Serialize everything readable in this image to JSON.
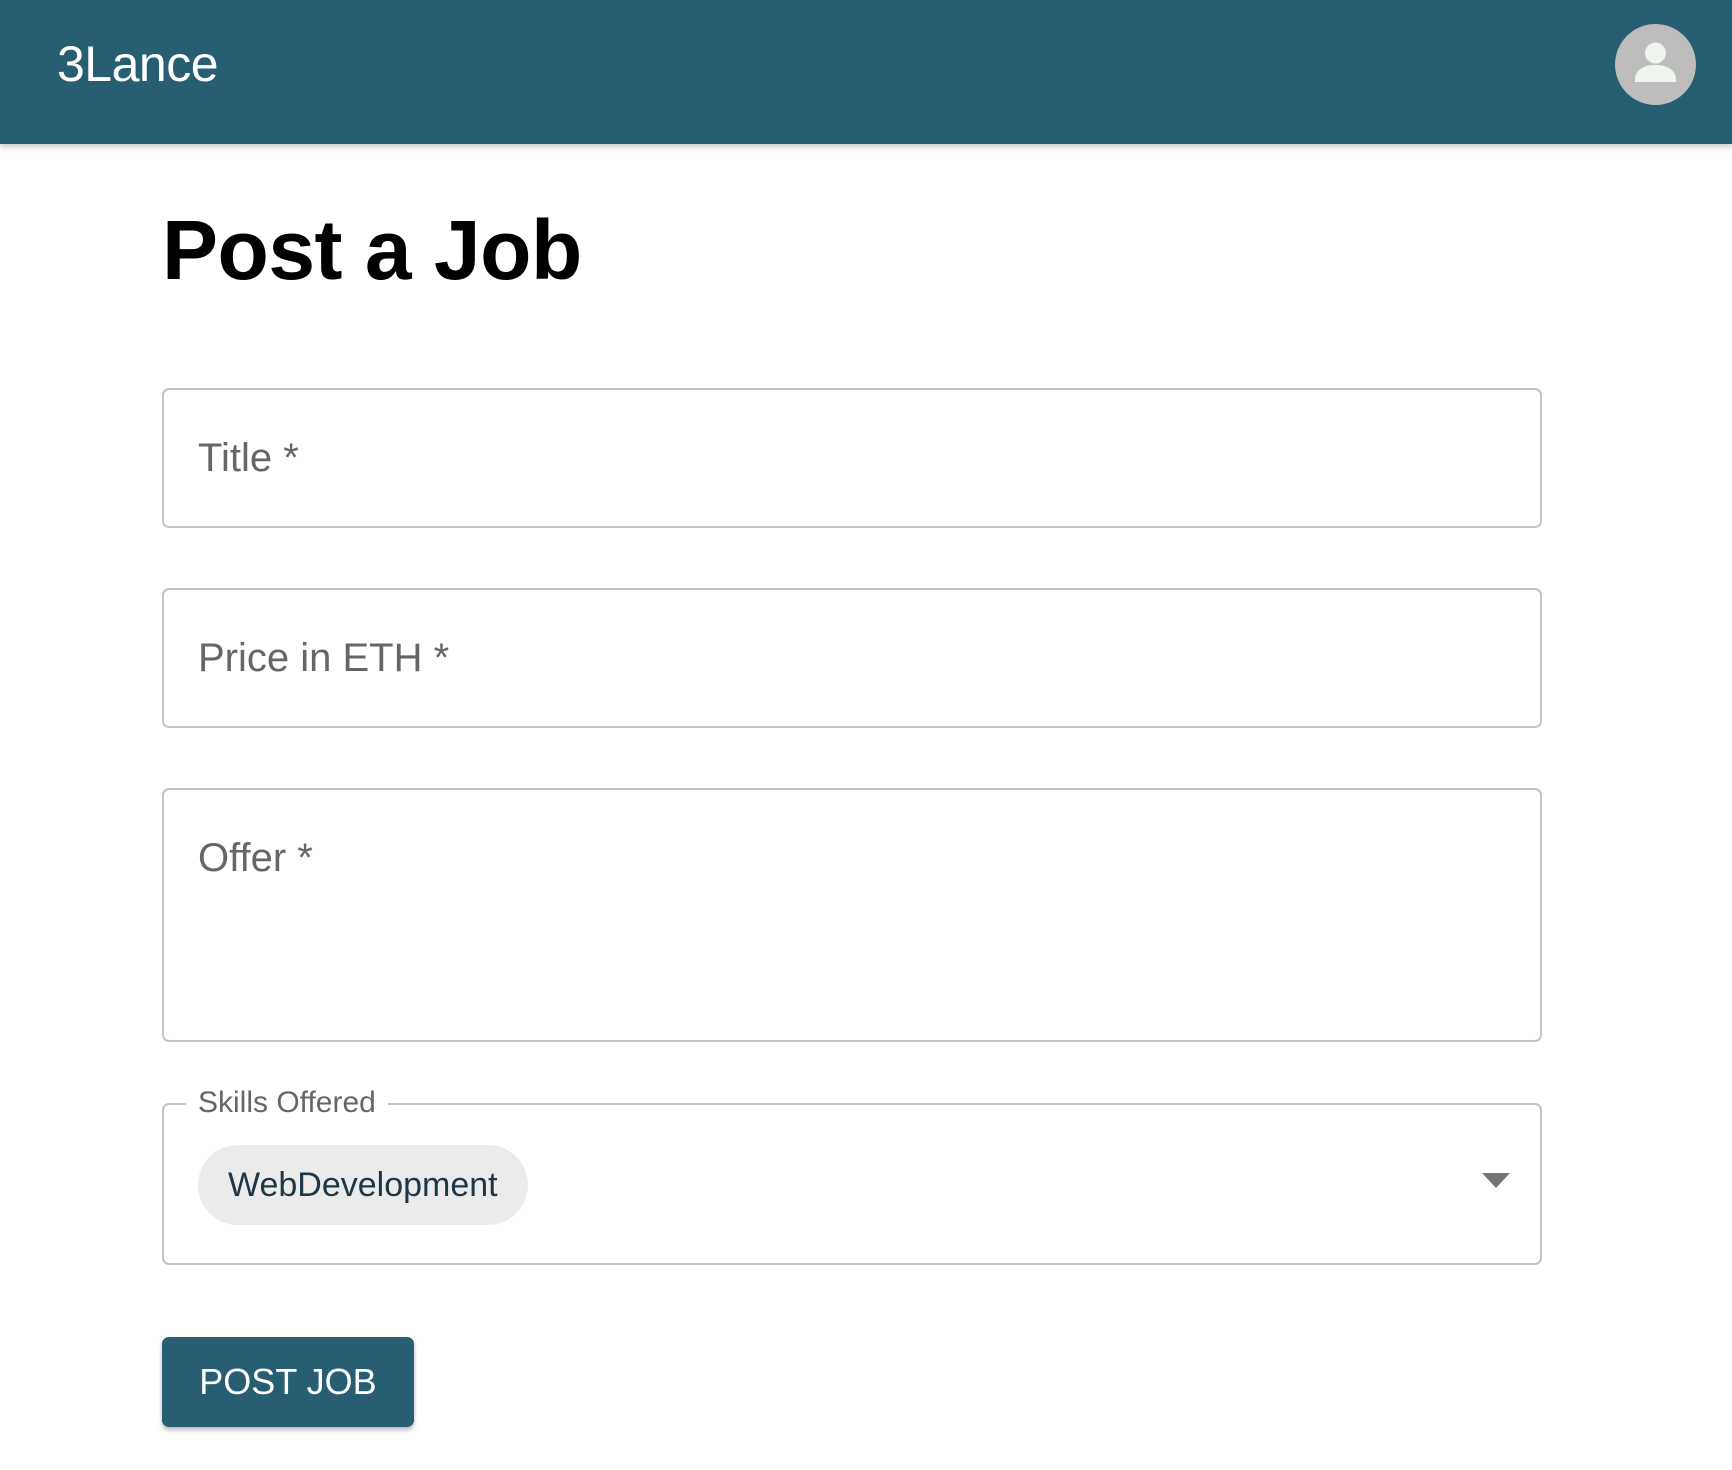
{
  "app": {
    "brand": "3Lance",
    "accent_color": "#275e72",
    "avatar_icon": "account-circle-icon"
  },
  "page": {
    "title": "Post a Job"
  },
  "form": {
    "title_field": {
      "label": "Title *",
      "value": ""
    },
    "price_field": {
      "label": "Price in ETH *",
      "value": ""
    },
    "offer_field": {
      "label": "Offer *",
      "value": ""
    },
    "skills_field": {
      "label": "Skills Offered",
      "selected": [
        "WebDevelopment"
      ],
      "dropdown_icon": "arrow-drop-down-icon"
    },
    "submit_label": "POST JOB"
  }
}
